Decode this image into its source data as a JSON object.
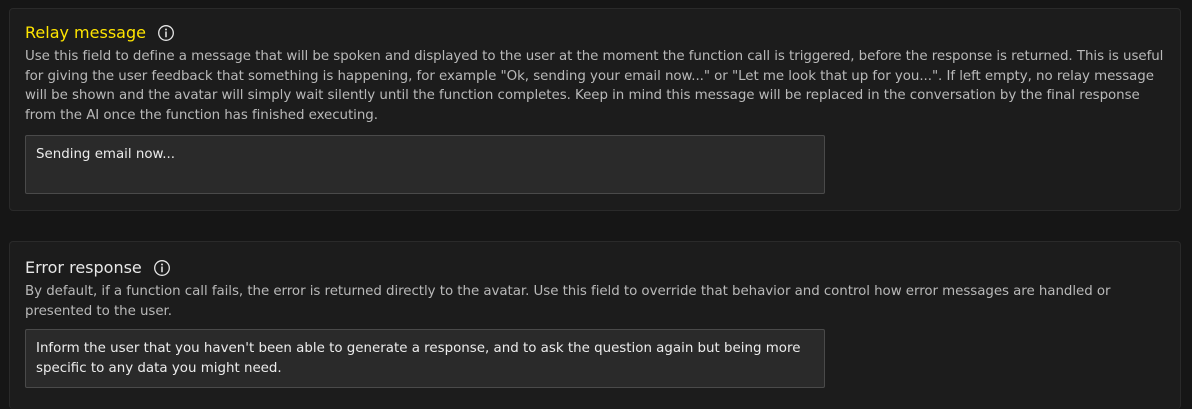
{
  "relay": {
    "title": "Relay message",
    "icon": "info-circle-icon",
    "accent_color": "#ffe500",
    "description": "Use this field to define a message that will be spoken and displayed to the user at the moment the function call is triggered, before the response is returned. This is useful for giving the user feedback that something is happening, for example \"Ok, sending your email now...\" or \"Let me look that up for you...\". If left empty, no relay message will be shown and the avatar will simply wait silently until the function completes. Keep in mind this message will be replaced in the conversation by the final response from the AI once the function has finished executing.",
    "value": "Sending email now..."
  },
  "error": {
    "title": "Error response",
    "icon": "info-circle-icon",
    "description": "By default, if a function call fails, the error is returned directly to the avatar. Use this field to override that behavior and control how error messages are handled or presented to the user.",
    "value": "Inform the user that you haven't been able to generate a response, and to ask the question again but being more specific to any data you might need."
  }
}
